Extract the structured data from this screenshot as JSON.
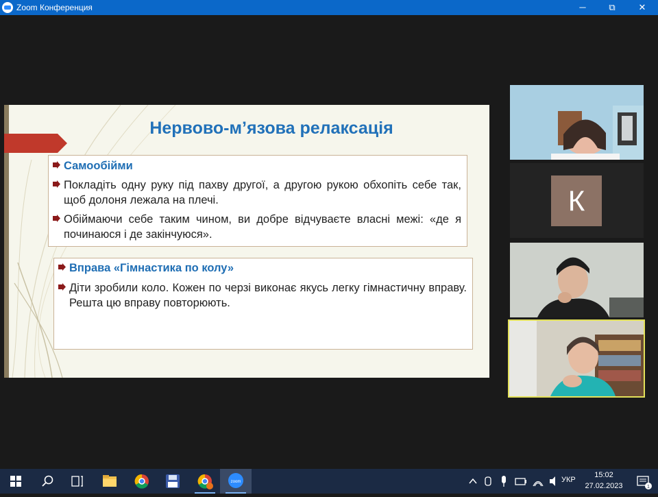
{
  "window": {
    "title": "Zoom Конференция",
    "controls": {
      "minimize": "─",
      "maximize": "⧉",
      "close": "✕"
    }
  },
  "slide": {
    "title": "Нервово-м’язова релаксація",
    "box1": {
      "heading": "Самообійми",
      "bullets": [
        "Покладіть одну руку під пахву другої, а другою рукою обхопіть себе так, щоб долоня лежала на плечі.",
        "Обіймаючи себе таким чином, ви добре відчуваєте власні межі: «де я починаюся і де закінчуюся»."
      ]
    },
    "box2": {
      "heading": "Вправа «Гімнастика по колу»",
      "bullets": [
        "Діти зробили коло. Кожен по черзі виконає якусь легку гімнастичну вправу. Решта цю вправу повторюють."
      ]
    },
    "colors": {
      "title": "#2171b9",
      "arrow": "#c0392b",
      "bullet": "#8b1a1a"
    }
  },
  "participants": [
    {
      "type": "video",
      "icon": "participant-video"
    },
    {
      "type": "avatar",
      "initial": "К",
      "color": "#8c7265"
    },
    {
      "type": "video",
      "icon": "participant-video"
    },
    {
      "type": "video",
      "icon": "participant-video",
      "active_speaker": true,
      "highlight": "#e3e15a"
    }
  ],
  "taskbar": {
    "apps": [
      "windows-start",
      "search",
      "task-view",
      "file-explorer",
      "chrome",
      "save-disk",
      "chrome-profile",
      "zoom"
    ],
    "active_app": "zoom",
    "tray": {
      "language": "УКР",
      "time": "15:02",
      "date": "27.02.2023"
    }
  }
}
